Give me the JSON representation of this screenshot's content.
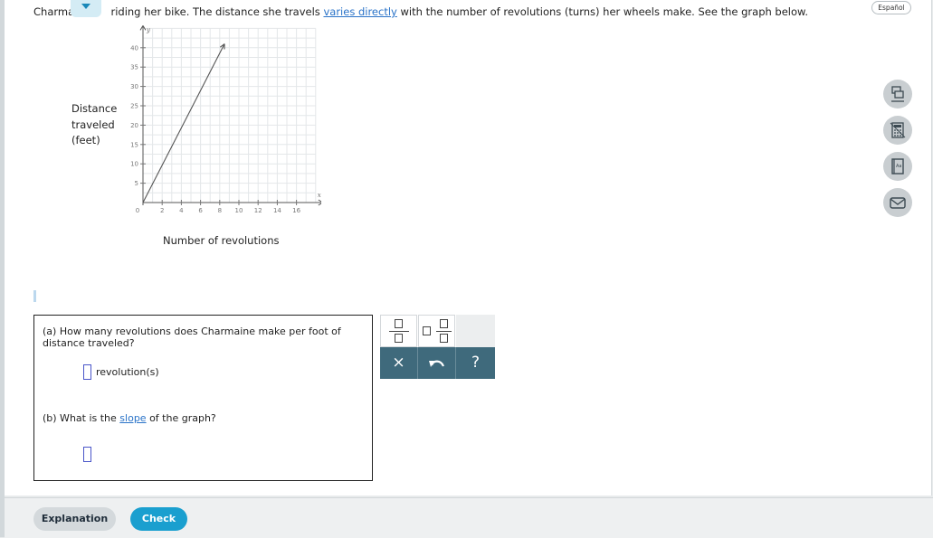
{
  "header": {
    "prompt_start": "Charma",
    "prompt_mid": "riding her bike. The distance she travels",
    "link_varies": "varies directly",
    "prompt_end": "with the number of revolutions (turns) her wheels make. See the graph below.",
    "language_button": "Español"
  },
  "chart_data": {
    "type": "line",
    "x": [
      0,
      8.5
    ],
    "y": [
      0,
      41
    ],
    "xlim": [
      0,
      18
    ],
    "ylim": [
      0,
      45
    ],
    "xticks": [
      2,
      4,
      6,
      8,
      10,
      12,
      14,
      16
    ],
    "yticks": [
      5,
      10,
      15,
      20,
      25,
      30,
      35,
      40
    ],
    "x_tick_labels": [
      "2",
      "4",
      "6",
      "8",
      "10",
      "12",
      "14",
      "16"
    ],
    "y_tick_labels": [
      "5",
      "10",
      "15",
      "20",
      "25",
      "30",
      "35",
      "40"
    ],
    "origin_label": "0",
    "x_axis_letter": "x",
    "y_axis_letter": "y",
    "ylabel_lines": [
      "Distance",
      "traveled",
      "(feet)"
    ],
    "xlabel": "Number of revolutions",
    "grid": true
  },
  "questions": {
    "a_text": "(a) How many revolutions does Charmaine make per foot of distance traveled?",
    "a_input_value": "",
    "a_unit": "revolution(s)",
    "b_text_start": "(b) What is the",
    "b_link": "slope",
    "b_text_end": "of the graph?",
    "b_input_value": ""
  },
  "keypad": {
    "fraction_icon": "fraction-icon",
    "mixed_number_icon": "mixed-number-icon",
    "clear_label": "×",
    "undo_icon": "undo-icon",
    "help_label": "?"
  },
  "tools": {
    "icons": [
      "accessibility-icon",
      "calculator-icon",
      "dictionary-icon",
      "mail-icon"
    ]
  },
  "footer": {
    "explanation_label": "Explanation",
    "check_label": "Check"
  },
  "colors": {
    "link": "#2a73c8",
    "check_button": "#1a9fcf",
    "keypad_dark": "#3f6a7c",
    "input_border": "#4a56c9"
  }
}
